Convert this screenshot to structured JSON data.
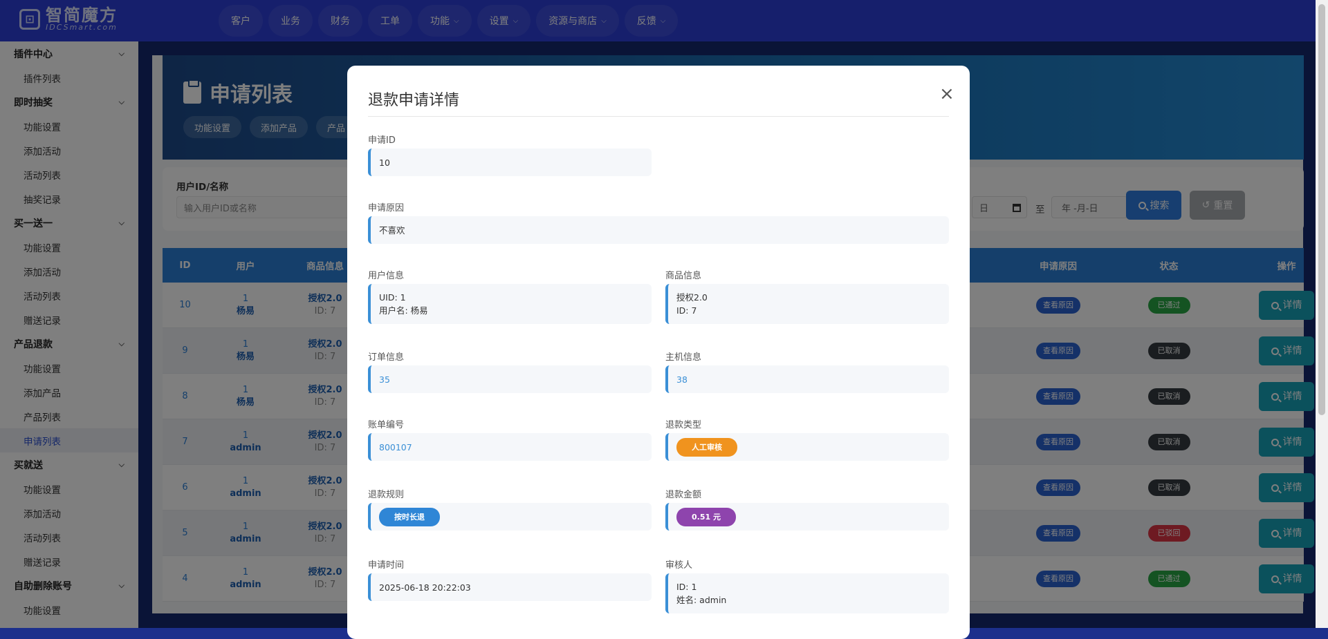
{
  "logo": {
    "name": "智简魔方",
    "sub": "IDCSmart.com"
  },
  "nav": [
    {
      "label": "客户",
      "has_menu": false
    },
    {
      "label": "业务",
      "has_menu": false
    },
    {
      "label": "财务",
      "has_menu": false
    },
    {
      "label": "工单",
      "has_menu": false
    },
    {
      "label": "功能",
      "has_menu": true
    },
    {
      "label": "设置",
      "has_menu": true
    },
    {
      "label": "资源与商店",
      "has_menu": true
    },
    {
      "label": "反馈",
      "has_menu": true
    }
  ],
  "sidebar": [
    {
      "group": "插件中心",
      "items": [
        "插件列表"
      ]
    },
    {
      "group": "即时抽奖",
      "items": [
        "功能设置",
        "添加活动",
        "活动列表",
        "抽奖记录"
      ]
    },
    {
      "group": "买一送一",
      "items": [
        "功能设置",
        "添加活动",
        "活动列表",
        "赠送记录"
      ]
    },
    {
      "group": "产品退款",
      "items": [
        "功能设置",
        "添加产品",
        "产品列表",
        "申请列表"
      ]
    },
    {
      "group": "买就送",
      "items": [
        "功能设置",
        "添加活动",
        "活动列表",
        "赠送记录"
      ]
    },
    {
      "group": "自助删除账号",
      "items": [
        "功能设置"
      ]
    }
  ],
  "sidebar_active": "申请列表",
  "page": {
    "title": "申请列表",
    "tabs": [
      "功能设置",
      "添加产品",
      "产品"
    ]
  },
  "filter": {
    "label": "用户ID/名称",
    "placeholder": "输入用户ID或名称",
    "date_from_text": "日",
    "date_sep": "至",
    "date_to_text": "年 -月-日",
    "search": "搜索",
    "reset": "重置"
  },
  "table": {
    "headers": [
      "ID",
      "用户",
      "商品信息",
      "申请原因",
      "状态",
      "操作"
    ],
    "rows": [
      {
        "id": "10",
        "uid": "1",
        "uname": "杨易",
        "product": "授权2.0",
        "pid": "ID: 7",
        "reason": "查看原因",
        "status": "已通过",
        "status_color": "#28a745",
        "action": "详情"
      },
      {
        "id": "9",
        "uid": "1",
        "uname": "杨易",
        "product": "授权2.0",
        "pid": "ID: 7",
        "reason": "查看原因",
        "status": "已取消",
        "status_color": "#343a40",
        "action": "详情"
      },
      {
        "id": "8",
        "uid": "1",
        "uname": "杨易",
        "product": "授权2.0",
        "pid": "ID: 7",
        "reason": "查看原因",
        "status": "已取消",
        "status_color": "#343a40",
        "action": "详情"
      },
      {
        "id": "7",
        "uid": "1",
        "uname": "admin",
        "product": "授权2.0",
        "pid": "ID: 7",
        "reason": "查看原因",
        "status": "已取消",
        "status_color": "#343a40",
        "action": "详情"
      },
      {
        "id": "6",
        "uid": "1",
        "uname": "admin",
        "product": "授权2.0",
        "pid": "ID: 7",
        "reason": "查看原因",
        "status": "已取消",
        "status_color": "#343a40",
        "action": "详情"
      },
      {
        "id": "5",
        "uid": "1",
        "uname": "admin",
        "product": "授权2.0",
        "pid": "ID: 7",
        "reason": "查看原因",
        "status": "已驳回",
        "status_color": "#dc3545",
        "action": "详情"
      },
      {
        "id": "4",
        "uid": "1",
        "uname": "admin",
        "product": "授权2.0",
        "pid": "ID: 7",
        "reason": "查看原因",
        "status": "已通过",
        "status_color": "#28a745",
        "action": "详情"
      }
    ]
  },
  "modal": {
    "title": "退款申请详情",
    "close": "×",
    "fields": {
      "apply_id": {
        "label": "申请ID",
        "value": "10"
      },
      "reason": {
        "label": "申请原因",
        "value": "不喜欢"
      },
      "user_info": {
        "label": "用户信息",
        "line1": "UID: 1",
        "line2": "用户名: 杨易"
      },
      "product_info": {
        "label": "商品信息",
        "line1": "授权2.0",
        "line2": "ID: 7"
      },
      "order_info": {
        "label": "订单信息",
        "value": "35"
      },
      "host_info": {
        "label": "主机信息",
        "value": "38"
      },
      "bill_no": {
        "label": "账单编号",
        "value": "800107"
      },
      "refund_type": {
        "label": "退款类型",
        "value": "人工审核",
        "color": "#f0931e"
      },
      "refund_rule": {
        "label": "退款规则",
        "value": "按时长退",
        "color": "#2f86d6"
      },
      "refund_amount": {
        "label": "退款金额",
        "value": "0.51 元",
        "color": "#8e44ad"
      },
      "apply_time": {
        "label": "申请时间",
        "value": "2025-06-18 20:22:03"
      },
      "reviewer": {
        "label": "审核人",
        "line1": "ID: 1",
        "line2": "姓名: admin"
      }
    }
  }
}
